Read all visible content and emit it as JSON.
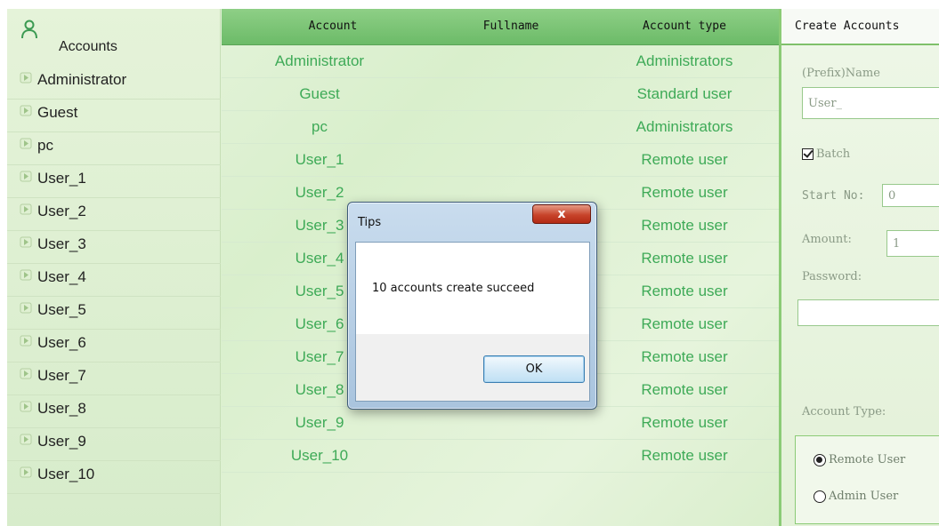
{
  "sidebar": {
    "title": "Accounts",
    "items": [
      {
        "label": "Administrator"
      },
      {
        "label": "Guest"
      },
      {
        "label": "pc"
      },
      {
        "label": "User_1"
      },
      {
        "label": "User_2"
      },
      {
        "label": "User_3"
      },
      {
        "label": "User_4"
      },
      {
        "label": "User_5"
      },
      {
        "label": "User_6"
      },
      {
        "label": "User_7"
      },
      {
        "label": "User_8"
      },
      {
        "label": "User_9"
      },
      {
        "label": "User_10"
      }
    ]
  },
  "table": {
    "headers": {
      "account": "Account",
      "fullname": "Fullname",
      "type": "Account type"
    },
    "rows": [
      {
        "account": "Administrator",
        "fullname": "",
        "type": "Administrators"
      },
      {
        "account": "Guest",
        "fullname": "",
        "type": "Standard user"
      },
      {
        "account": "pc",
        "fullname": "",
        "type": "Administrators"
      },
      {
        "account": "User_1",
        "fullname": "",
        "type": "Remote user"
      },
      {
        "account": "User_2",
        "fullname": "",
        "type": "Remote user"
      },
      {
        "account": "User_3",
        "fullname": "",
        "type": "Remote user"
      },
      {
        "account": "User_4",
        "fullname": "",
        "type": "Remote user"
      },
      {
        "account": "User_5",
        "fullname": "",
        "type": "Remote user"
      },
      {
        "account": "User_6",
        "fullname": "",
        "type": "Remote user"
      },
      {
        "account": "User_7",
        "fullname": "",
        "type": "Remote user"
      },
      {
        "account": "User_8",
        "fullname": "",
        "type": "Remote user"
      },
      {
        "account": "User_9",
        "fullname": "",
        "type": "Remote user"
      },
      {
        "account": "User_10",
        "fullname": "",
        "type": "Remote user"
      }
    ]
  },
  "create_panel": {
    "title": "Create Accounts",
    "name_label": "(Prefix)Name",
    "name_value": "User_",
    "batch_label": "Batch",
    "batch_checked": true,
    "start_label": "Start No:",
    "start_value": "0",
    "amount_label": "Amount:",
    "amount_value": "1",
    "password_label": "Password:",
    "password_value": "",
    "account_type_label": "Account Type:",
    "options": [
      {
        "label": "Remote User",
        "checked": true
      },
      {
        "label": "Admin User",
        "checked": false
      }
    ]
  },
  "dialog": {
    "title": "Tips",
    "close_label": "x",
    "message": "10 accounts create succeed",
    "ok_label": "OK"
  },
  "colors": {
    "accent_green": "#3eaa57",
    "header_green": "#7cc574",
    "close_red": "#c7432a"
  },
  "icons": {
    "sidebar_header": "user-outline-icon",
    "item": "user-tag-icon"
  }
}
